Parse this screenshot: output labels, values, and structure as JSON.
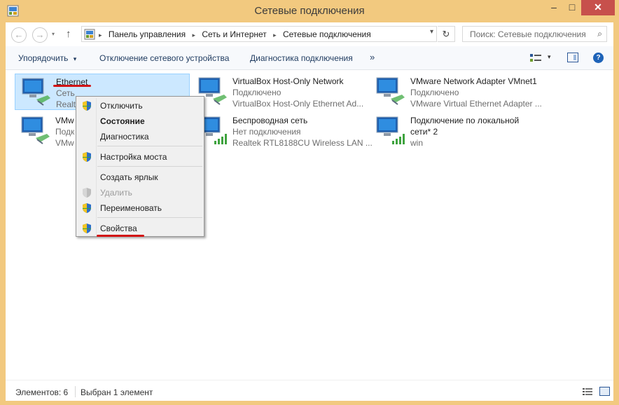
{
  "window": {
    "title": "Сетевые подключения",
    "minimize_glyph": "–",
    "maximize_glyph": "□",
    "close_glyph": "✕",
    "app_icon": "network-connections-icon"
  },
  "nav": {
    "back_glyph": "←",
    "forward_glyph": "→",
    "history_glyph": "▾",
    "up_glyph": "↑",
    "breadcrumbs": [
      "Панель управления",
      "Сеть и Интернет",
      "Сетевые подключения"
    ],
    "breadcrumb_sep": "▸",
    "address_dropdown_glyph": "▾",
    "refresh_glyph": "↻",
    "search_placeholder": "Поиск: Сетевые подключения",
    "search_glyph": "⌕"
  },
  "toolbar": {
    "organize": "Упорядочить",
    "organize_caret": "▾",
    "disable_device": "Отключение сетевого устройства",
    "diagnose": "Диагностика подключения",
    "more": "»",
    "view_caret": "▾",
    "help": "?"
  },
  "connections": [
    {
      "name": "Ethernet",
      "status": "Сеть",
      "device": "Realtek PCIe GBE Family Controller",
      "device_visible": "Realte",
      "icon": "ethernet-adapter-icon",
      "selected": true
    },
    {
      "name": "VirtualBox Host-Only Network",
      "status": "Подключено",
      "device": "VirtualBox Host-Only Ethernet Ad...",
      "icon": "ethernet-adapter-icon"
    },
    {
      "name": "VMware Network Adapter VMnet1",
      "status": "Подключено",
      "device": "VMware Virtual Ethernet Adapter ...",
      "icon": "ethernet-adapter-icon"
    },
    {
      "name_visible": "VMw",
      "status_visible": "Подк",
      "device_visible": "VMw",
      "icon": "ethernet-adapter-icon"
    },
    {
      "name": "Беспроводная сеть",
      "status": "Нет подключения",
      "device": "Realtek RTL8188CU Wireless LAN ...",
      "icon": "wireless-adapter-icon"
    },
    {
      "name_line1": "Подключение по локальной",
      "name_line2": "сети* 2",
      "status": "win",
      "icon": "wireless-adapter-icon"
    }
  ],
  "context_menu": {
    "items": [
      {
        "label": "Отключить",
        "shield": true
      },
      {
        "label": "Состояние",
        "bold": true
      },
      {
        "label": "Диагностика"
      },
      {
        "label": "Настройка моста",
        "shield": true
      },
      {
        "label": "Создать ярлык"
      },
      {
        "label": "Удалить",
        "shield": true,
        "disabled": true
      },
      {
        "label": "Переименовать",
        "shield": true
      },
      {
        "label": "Свойства",
        "shield": true
      }
    ]
  },
  "statusbar": {
    "count": "Элементов: 6",
    "selected": "Выбран 1 элемент"
  },
  "colors": {
    "frame": "#f2c97f",
    "selection": "#cce8ff",
    "annotation_red": "#d21414",
    "close_button": "#c7504c"
  }
}
